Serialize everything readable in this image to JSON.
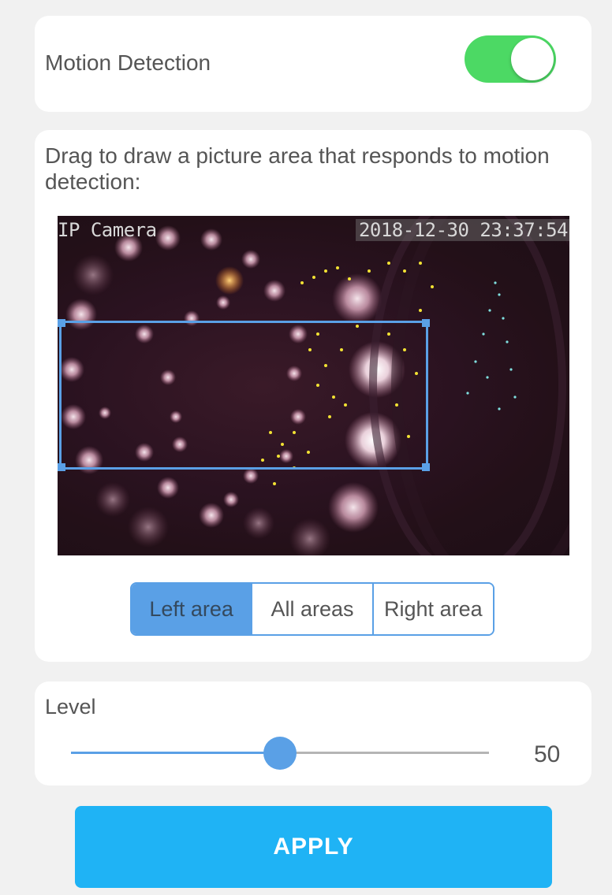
{
  "motion": {
    "label": "Motion Detection",
    "enabled": true,
    "toggle_on_color": "#4cd964"
  },
  "area": {
    "instruction": "Drag to draw a picture area that responds to motion detection:",
    "camera": {
      "name_overlay": "IP Camera",
      "timestamp_overlay": "2018-12-30 23:37:54"
    },
    "selection_color": "#5aa0e6",
    "options": [
      {
        "label": "Left area",
        "selected": true
      },
      {
        "label": "All areas",
        "selected": false
      },
      {
        "label": "Right area",
        "selected": false
      }
    ]
  },
  "level": {
    "label": "Level",
    "value": 50,
    "value_text": "50",
    "min": 0,
    "max": 100
  },
  "apply": {
    "label": "APPLY",
    "color": "#1fb3f5"
  }
}
